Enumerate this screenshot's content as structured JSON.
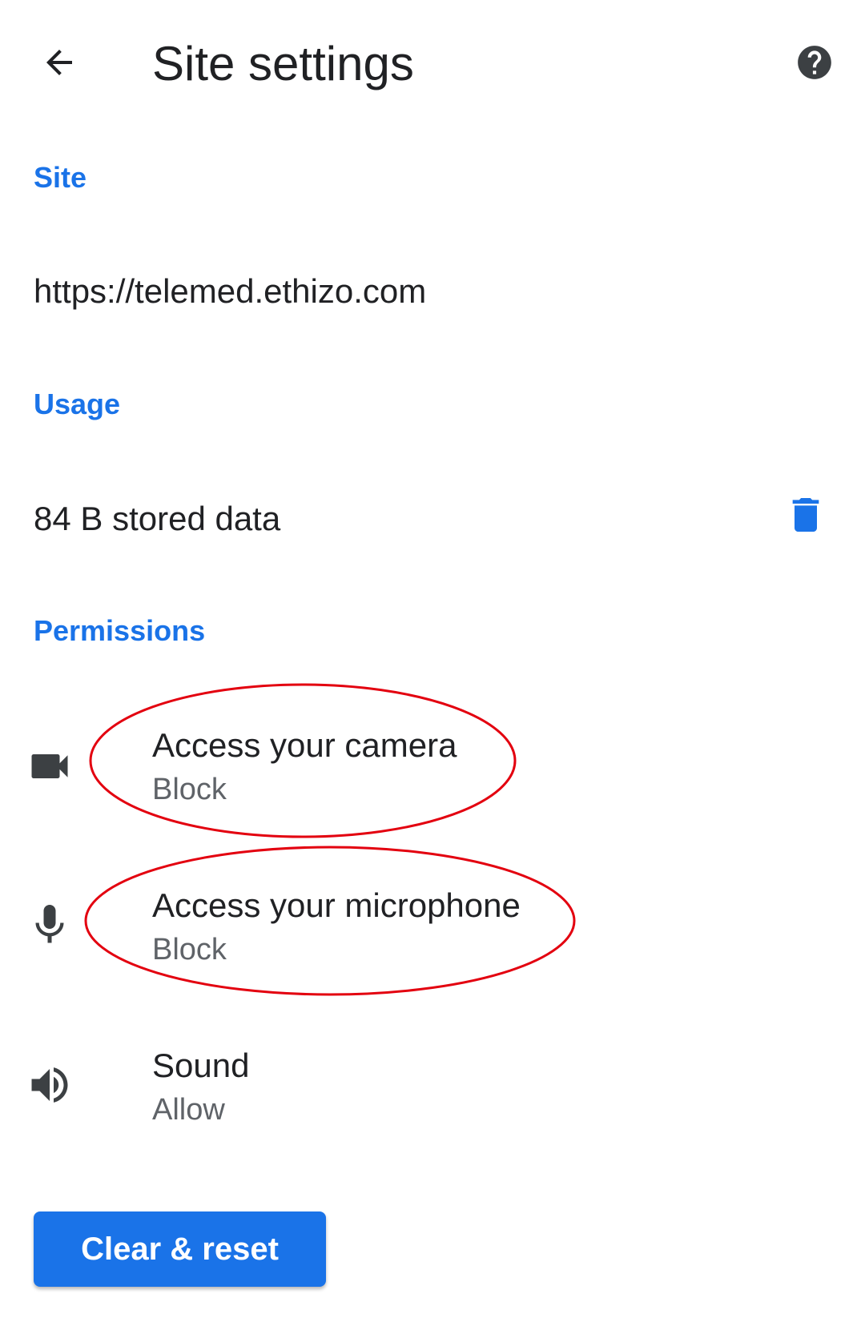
{
  "app_bar": {
    "title": "Site settings",
    "back_icon": "arrow-back-icon",
    "help_icon": "help-circle-icon"
  },
  "site_section": {
    "header": "Site",
    "url": "https://telemed.ethizo.com"
  },
  "usage_section": {
    "header": "Usage",
    "stored_data": "84 B stored data",
    "delete_icon": "trash-icon"
  },
  "permissions_section": {
    "header": "Permissions",
    "items": [
      {
        "icon": "videocam-icon",
        "title": "Access your camera",
        "value": "Block"
      },
      {
        "icon": "microphone-icon",
        "title": "Access your microphone",
        "value": "Block"
      },
      {
        "icon": "volume-icon",
        "title": "Sound",
        "value": "Allow"
      }
    ]
  },
  "footer": {
    "clear_reset_label": "Clear & reset"
  },
  "colors": {
    "accent": "#1a73e8",
    "text_primary": "#202124",
    "text_secondary": "#5f6368",
    "icon": "#3c4043",
    "annotation": "#e3000f"
  }
}
